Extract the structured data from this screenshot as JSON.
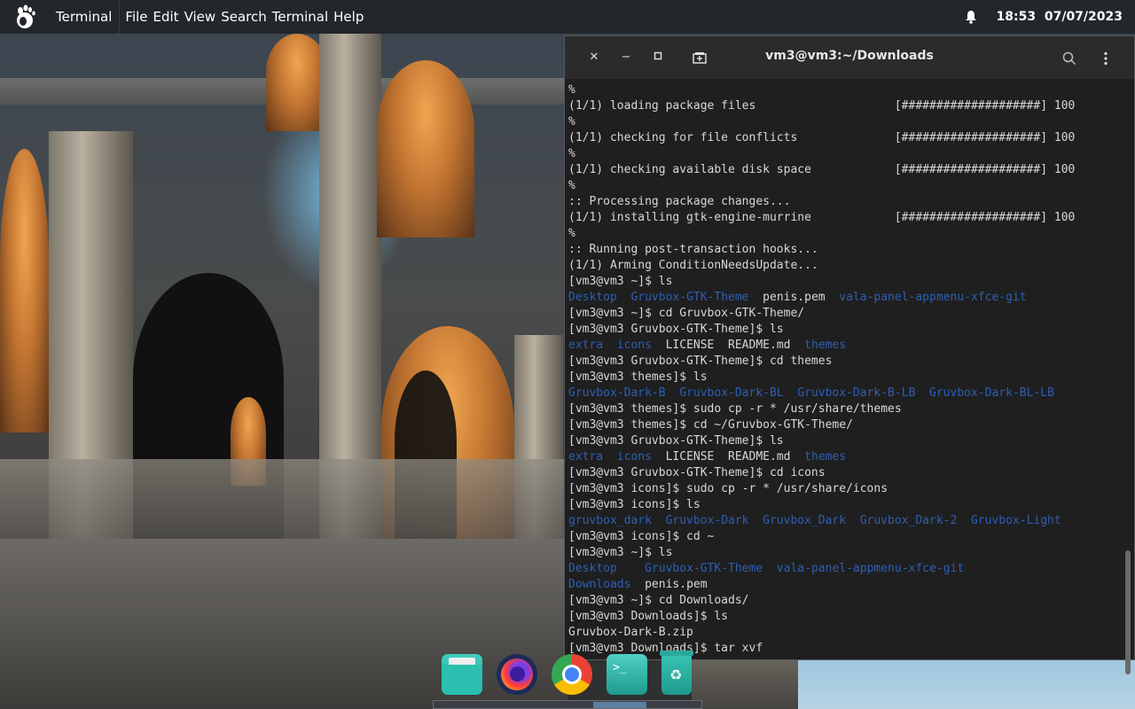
{
  "top_panel": {
    "app_menu": [
      "Terminal",
      "File",
      "Edit",
      "View",
      "Search",
      "Terminal",
      "Help"
    ],
    "clock": "18:53  07/07/2023"
  },
  "terminal": {
    "title": "vm3@vm3:~/Downloads",
    "lines": [
      [
        {
          "t": "%"
        }
      ],
      [
        {
          "t": "(1/1) loading package files                    [####################] 100"
        }
      ],
      [
        {
          "t": "%"
        }
      ],
      [
        {
          "t": "(1/1) checking for file conflicts              [####################] 100"
        }
      ],
      [
        {
          "t": "%"
        }
      ],
      [
        {
          "t": "(1/1) checking available disk space            [####################] 100"
        }
      ],
      [
        {
          "t": "%"
        }
      ],
      [
        {
          "t": ":: Processing package changes..."
        }
      ],
      [
        {
          "t": "(1/1) installing gtk-engine-murrine            [####################] 100"
        }
      ],
      [
        {
          "t": "%"
        }
      ],
      [
        {
          "t": ":: Running post-transaction hooks..."
        }
      ],
      [
        {
          "t": "(1/1) Arming ConditionNeedsUpdate..."
        }
      ],
      [
        {
          "t": "[vm3@vm3 ~]$ ls"
        }
      ],
      [
        {
          "t": "Desktop",
          "d": true
        },
        {
          "t": "  "
        },
        {
          "t": "Gruvbox-GTK-Theme",
          "d": true
        },
        {
          "t": "  penis.pem  "
        },
        {
          "t": "vala-panel-appmenu-xfce-git",
          "d": true
        }
      ],
      [
        {
          "t": "[vm3@vm3 ~]$ cd Gruvbox-GTK-Theme/"
        }
      ],
      [
        {
          "t": "[vm3@vm3 Gruvbox-GTK-Theme]$ ls"
        }
      ],
      [
        {
          "t": "extra",
          "d": true
        },
        {
          "t": "  "
        },
        {
          "t": "icons",
          "d": true
        },
        {
          "t": "  LICENSE  README.md  "
        },
        {
          "t": "themes",
          "d": true
        }
      ],
      [
        {
          "t": "[vm3@vm3 Gruvbox-GTK-Theme]$ cd themes"
        }
      ],
      [
        {
          "t": "[vm3@vm3 themes]$ ls"
        }
      ],
      [
        {
          "t": "Gruvbox-Dark-B",
          "d": true
        },
        {
          "t": "  "
        },
        {
          "t": "Gruvbox-Dark-BL",
          "d": true
        },
        {
          "t": "  "
        },
        {
          "t": "Gruvbox-Dark-B-LB",
          "d": true
        },
        {
          "t": "  "
        },
        {
          "t": "Gruvbox-Dark-BL-LB",
          "d": true
        }
      ],
      [
        {
          "t": "[vm3@vm3 themes]$ sudo cp -r * /usr/share/themes"
        }
      ],
      [
        {
          "t": "[vm3@vm3 themes]$ cd ~/Gruvbox-GTK-Theme/"
        }
      ],
      [
        {
          "t": "[vm3@vm3 Gruvbox-GTK-Theme]$ ls"
        }
      ],
      [
        {
          "t": "extra",
          "d": true
        },
        {
          "t": "  "
        },
        {
          "t": "icons",
          "d": true
        },
        {
          "t": "  LICENSE  README.md  "
        },
        {
          "t": "themes",
          "d": true
        }
      ],
      [
        {
          "t": "[vm3@vm3 Gruvbox-GTK-Theme]$ cd icons"
        }
      ],
      [
        {
          "t": "[vm3@vm3 icons]$ sudo cp -r * /usr/share/icons"
        }
      ],
      [
        {
          "t": "[vm3@vm3 icons]$ ls"
        }
      ],
      [
        {
          "t": "gruvbox_dark",
          "d": true
        },
        {
          "t": "  "
        },
        {
          "t": "Gruvbox-Dark",
          "d": true
        },
        {
          "t": "  "
        },
        {
          "t": "Gruvbox_Dark",
          "d": true
        },
        {
          "t": "  "
        },
        {
          "t": "Gruvbox_Dark-2",
          "d": true
        },
        {
          "t": "  "
        },
        {
          "t": "Gruvbox-Light",
          "d": true
        }
      ],
      [
        {
          "t": "[vm3@vm3 icons]$ cd ~"
        }
      ],
      [
        {
          "t": "[vm3@vm3 ~]$ ls"
        }
      ],
      [
        {
          "t": "Desktop",
          "d": true
        },
        {
          "t": "    "
        },
        {
          "t": "Gruvbox-GTK-Theme",
          "d": true
        },
        {
          "t": "  "
        },
        {
          "t": "vala-panel-appmenu-xfce-git",
          "d": true
        }
      ],
      [
        {
          "t": "Downloads",
          "d": true
        },
        {
          "t": "  penis.pem"
        }
      ],
      [
        {
          "t": "[vm3@vm3 ~]$ cd Downloads/"
        }
      ],
      [
        {
          "t": "[vm3@vm3 Downloads]$ ls"
        }
      ],
      [
        {
          "t": "Gruvbox-Dark-B.zip"
        }
      ],
      [
        {
          "t": "[vm3@vm3 Downloads]$ tar xvf"
        }
      ]
    ]
  },
  "dock": {
    "items": [
      {
        "name": "files-icon",
        "color": "#29b6a8"
      },
      {
        "name": "firefox-icon",
        "color": "#ff7139"
      },
      {
        "name": "chrome-icon",
        "color": "#4285f4"
      },
      {
        "name": "terminal-app-icon",
        "color": "#26a69a"
      },
      {
        "name": "trash-icon",
        "color": "#26a69a"
      }
    ]
  },
  "colors": {
    "directory": "#2d5fb4",
    "text": "#d8d8d8",
    "terminal_bg": "#1f1f1f",
    "panel_bg": "#23262b"
  }
}
